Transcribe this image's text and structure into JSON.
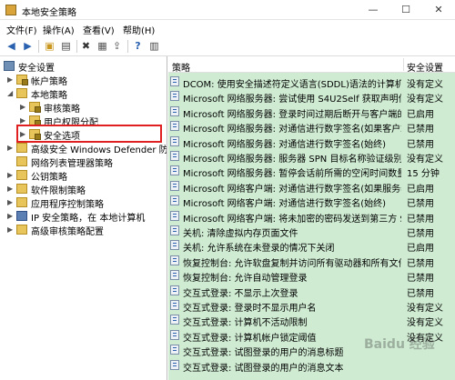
{
  "window": {
    "title": "本地安全策略"
  },
  "menu": [
    "文件(F)",
    "操作(A)",
    "查看(V)",
    "帮助(H)"
  ],
  "toolbar_icons": [
    "back-arrow-icon",
    "forward-arrow-icon",
    "up-folder-icon",
    "show-tree-icon",
    "delete-icon",
    "properties-icon",
    "export-icon",
    "help-icon",
    "view-icon"
  ],
  "tree": [
    {
      "label": "安全设置",
      "twisty": ""
    },
    {
      "label": "帐户策略",
      "twisty": "▶"
    },
    {
      "label": "本地策略",
      "twisty": "◢"
    },
    {
      "label": "审核策略",
      "twisty": "▶"
    },
    {
      "label": "用户权限分配",
      "twisty": "▶"
    },
    {
      "label": "安全选项",
      "twisty": "▶"
    },
    {
      "label": "高级安全 Windows Defender 防火墙",
      "twisty": "▶"
    },
    {
      "label": "网络列表管理器策略",
      "twisty": ""
    },
    {
      "label": "公钥策略",
      "twisty": "▶"
    },
    {
      "label": "软件限制策略",
      "twisty": "▶"
    },
    {
      "label": "应用程序控制策略",
      "twisty": "▶"
    },
    {
      "label": "IP 安全策略，在 本地计算机",
      "twisty": "▶"
    },
    {
      "label": "高级审核策略配置",
      "twisty": "▶"
    }
  ],
  "list": {
    "headers": {
      "policy": "策略",
      "setting": "安全设置"
    },
    "rows": [
      {
        "name": "DCOM: 使用安全描述符定义语言(SDDL)语法的计算机启动...",
        "value": "没有定义"
      },
      {
        "name": "Microsoft 网络服务器: 尝试使用 S4U2Self 获取声明信息",
        "value": "没有定义"
      },
      {
        "name": "Microsoft 网络服务器: 登录时间过期后断开与客户端的连接",
        "value": "已启用"
      },
      {
        "name": "Microsoft 网络服务器: 对通信进行数字签名(如果客户端允...",
        "value": "已禁用"
      },
      {
        "name": "Microsoft 网络服务器: 对通信进行数字签名(始终)",
        "value": "已禁用"
      },
      {
        "name": "Microsoft 网络服务器: 服务器 SPN 目标名称验证级别",
        "value": "没有定义"
      },
      {
        "name": "Microsoft 网络服务器: 暂停会话前所需的空闲时间数量",
        "value": "15 分钟"
      },
      {
        "name": "Microsoft 网络客户端: 对通信进行数字签名(如果服务器允...",
        "value": "已启用"
      },
      {
        "name": "Microsoft 网络客户端: 对通信进行数字签名(始终)",
        "value": "已禁用"
      },
      {
        "name": "Microsoft 网络客户端: 将未加密的密码发送到第三方 SMB...",
        "value": "已禁用"
      },
      {
        "name": "关机: 清除虚拟内存页面文件",
        "value": "已禁用"
      },
      {
        "name": "关机: 允许系统在未登录的情况下关闭",
        "value": "已启用"
      },
      {
        "name": "恢复控制台: 允许软盘复制并访问所有驱动器和所有文件夹",
        "value": "已禁用"
      },
      {
        "name": "恢复控制台: 允许自动管理登录",
        "value": "已禁用"
      },
      {
        "name": "交互式登录: 不显示上次登录",
        "value": "已禁用"
      },
      {
        "name": "交互式登录: 登录时不显示用户名",
        "value": "没有定义"
      },
      {
        "name": "交互式登录: 计算机不活动限制",
        "value": "没有定义"
      },
      {
        "name": "交互式登录: 计算机帐户锁定阈值",
        "value": "没有定义"
      },
      {
        "name": "交互式登录: 试图登录的用户的消息标题",
        "value": ""
      },
      {
        "name": "交互式登录: 试图登录的用户的消息文本",
        "value": ""
      }
    ]
  },
  "watermark": "Baidu 经验"
}
